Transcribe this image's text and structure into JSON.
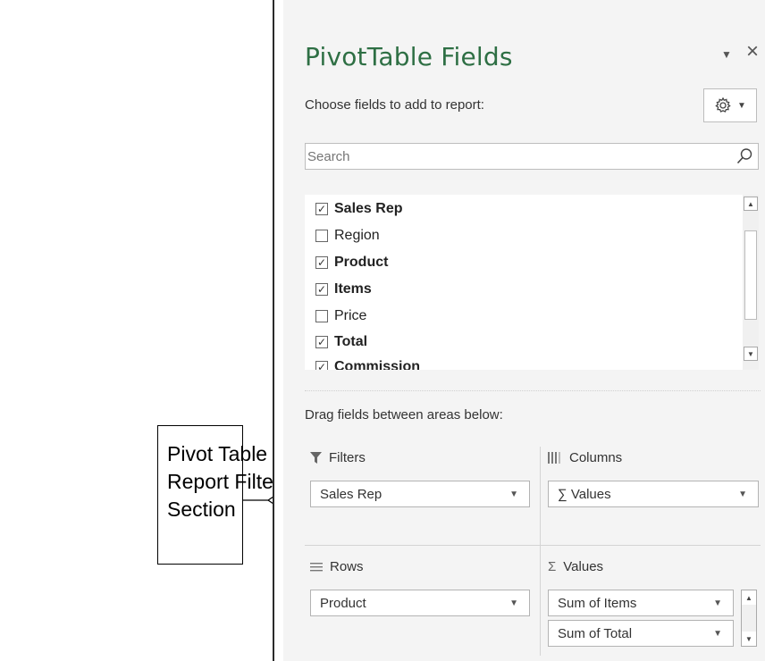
{
  "callout": {
    "text": "Pivot Table\nReport Filter\nSection"
  },
  "panel": {
    "title": "PivotTable Fields",
    "choose_label": "Choose fields to add to report:",
    "search": {
      "placeholder": "Search",
      "value": "Search"
    },
    "fields": [
      {
        "label": "Sales Rep",
        "checked": true,
        "bold": true
      },
      {
        "label": "Region",
        "checked": false,
        "bold": false
      },
      {
        "label": "Product",
        "checked": true,
        "bold": true
      },
      {
        "label": "Items",
        "checked": true,
        "bold": true
      },
      {
        "label": "Price",
        "checked": false,
        "bold": false
      },
      {
        "label": "Total",
        "checked": true,
        "bold": true
      },
      {
        "label": "Commission",
        "checked": true,
        "bold": true
      }
    ],
    "drag_label": "Drag fields between areas below:",
    "areas": {
      "filters": {
        "label": "Filters",
        "items": [
          "Sales Rep"
        ]
      },
      "columns": {
        "label": "Columns",
        "items": [
          "∑ Values"
        ]
      },
      "rows": {
        "label": "Rows",
        "items": [
          "Product"
        ]
      },
      "values": {
        "label": "Values",
        "items": [
          "Sum of Items",
          "Sum of Total"
        ]
      }
    }
  },
  "colors": {
    "title": "#2e6f44",
    "panel_bg": "#f4f4f4"
  }
}
